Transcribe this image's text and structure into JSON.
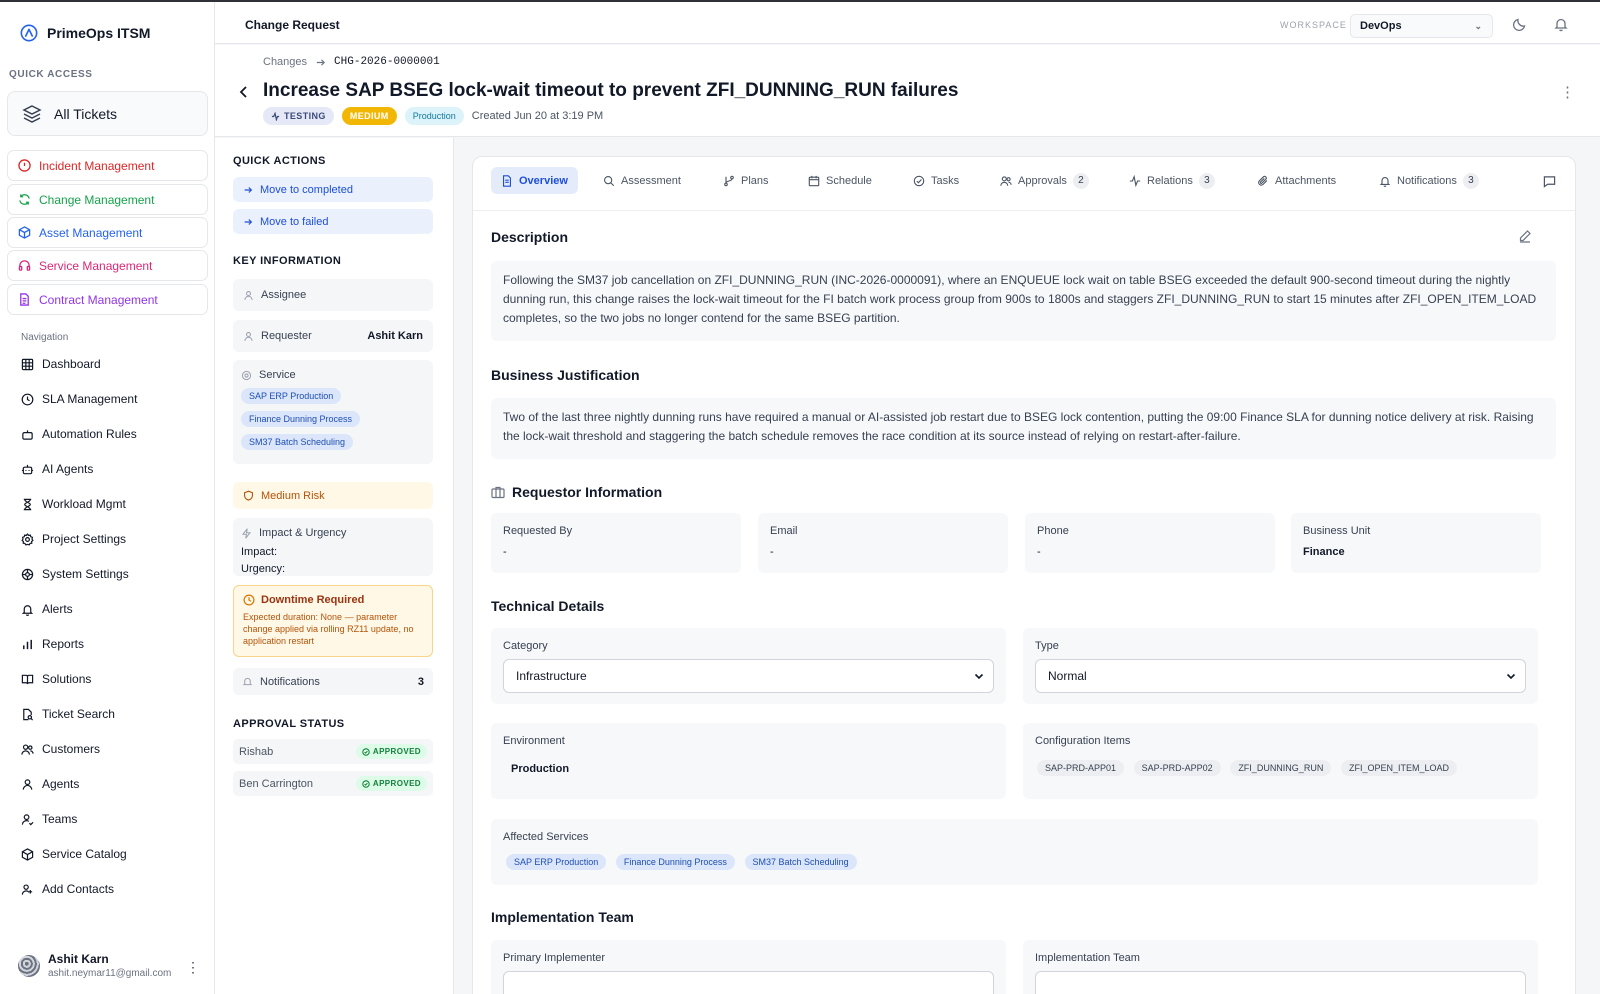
{
  "app": {
    "name": "PrimeOps ITSM"
  },
  "sidebar": {
    "quick_access_label": "QUICK ACCESS",
    "all_tickets": "All Tickets",
    "modules": [
      {
        "label": "Incident Management",
        "color": "#dc2626"
      },
      {
        "label": "Change Management",
        "color": "#16a34a"
      },
      {
        "label": "Asset Management",
        "color": "#2563eb"
      },
      {
        "label": "Service Management",
        "color": "#db2777"
      },
      {
        "label": "Contract Management",
        "color": "#9333ea"
      }
    ],
    "nav_label": "Navigation",
    "nav": [
      {
        "label": "Dashboard",
        "icon": "grid-icon"
      },
      {
        "label": "SLA Management",
        "icon": "clock-icon"
      },
      {
        "label": "Automation Rules",
        "icon": "robot-icon"
      },
      {
        "label": "AI Agents",
        "icon": "bot-icon"
      },
      {
        "label": "Workload Mgmt",
        "icon": "hourglass-icon"
      },
      {
        "label": "Project Settings",
        "icon": "gear-icon"
      },
      {
        "label": "System Settings",
        "icon": "cog-icon"
      },
      {
        "label": "Alerts",
        "icon": "bell-icon"
      },
      {
        "label": "Reports",
        "icon": "bar-chart-icon"
      },
      {
        "label": "Solutions",
        "icon": "book-icon"
      },
      {
        "label": "Ticket Search",
        "icon": "file-search-icon"
      },
      {
        "label": "Customers",
        "icon": "users-icon"
      },
      {
        "label": "Agents",
        "icon": "user-icon"
      },
      {
        "label": "Teams",
        "icon": "user-check-icon"
      },
      {
        "label": "Service Catalog",
        "icon": "box-icon"
      },
      {
        "label": "Add Contacts",
        "icon": "contact-icon"
      }
    ],
    "user": {
      "name": "Ashit Karn",
      "email": "ashit.neymar11@gmail.com"
    }
  },
  "topbar": {
    "title": "Change Request",
    "workspace_label": "WORKSPACE",
    "workspace_value": "DevOps"
  },
  "header": {
    "breadcrumb_parent": "Changes",
    "change_id": "CHG-2026-0000001",
    "title": "Increase SAP BSEG lock-wait timeout to prevent ZFI_DUNNING_RUN failures",
    "status": "TESTING",
    "priority": "MEDIUM",
    "environment": "Production",
    "created": "Created Jun 20 at 3:19 PM"
  },
  "left_panel": {
    "quick_actions_label": "QUICK ACTIONS",
    "actions": [
      "Move to completed",
      "Move to failed"
    ],
    "key_info_label": "KEY INFORMATION",
    "assignee_label": "Assignee",
    "requester_label": "Requester",
    "requester_value": "Ashit Karn",
    "service_label": "Service",
    "services": [
      "SAP ERP Production",
      "Finance Dunning Process",
      "SM37 Batch Scheduling"
    ],
    "risk": "Medium Risk",
    "impact_urgency_label": "Impact & Urgency",
    "impact_label": "Impact:",
    "urgency_label": "Urgency:",
    "downtime_title": "Downtime Required",
    "downtime_text": "Expected duration: None — parameter change applied via rolling RZ11 update, no application restart",
    "notifications_label": "Notifications",
    "notifications_count": "3",
    "approval_status_label": "APPROVAL STATUS",
    "approvals": [
      {
        "name": "Rishab",
        "status": "APPROVED"
      },
      {
        "name": "Ben Carrington",
        "status": "APPROVED"
      }
    ]
  },
  "tabs": [
    {
      "label": "Overview",
      "icon": "document-icon",
      "count": ""
    },
    {
      "label": "Assessment",
      "icon": "search-icon",
      "count": ""
    },
    {
      "label": "Plans",
      "icon": "git-branch-icon",
      "count": ""
    },
    {
      "label": "Schedule",
      "icon": "calendar-icon",
      "count": ""
    },
    {
      "label": "Tasks",
      "icon": "check-circle-icon",
      "count": ""
    },
    {
      "label": "Approvals",
      "icon": "users-icon",
      "count": "2"
    },
    {
      "label": "Relations",
      "icon": "activity-icon",
      "count": "3"
    },
    {
      "label": "Attachments",
      "icon": "paperclip-icon",
      "count": ""
    },
    {
      "label": "Notifications",
      "icon": "bell-icon",
      "count": "3"
    }
  ],
  "overview": {
    "description_label": "Description",
    "description": "Following the SM37 job cancellation on ZFI_DUNNING_RUN (INC-2026-0000091), where an ENQUEUE lock wait on table BSEG exceeded the default 900-second timeout during the nightly dunning run, this change raises the lock-wait timeout for the FI batch work process group from 900s to 1800s and staggers ZFI_DUNNING_RUN to start 15 minutes after ZFI_OPEN_ITEM_LOAD completes, so the two jobs no longer contend for the same BSEG partition.",
    "justification_label": "Business Justification",
    "justification": "Two of the last three nightly dunning runs have required a manual or AI-assisted job restart due to BSEG lock contention, putting the 09:00 Finance SLA for dunning notice delivery at risk. Raising the lock-wait threshold and staggering the batch schedule removes the race condition at its source instead of relying on restart-after-failure.",
    "requestor_label": "Requestor Information",
    "requestor": [
      {
        "key": "Requested By",
        "value": "-"
      },
      {
        "key": "Email",
        "value": "-"
      },
      {
        "key": "Phone",
        "value": "-"
      },
      {
        "key": "Business Unit",
        "value": "Finance"
      }
    ],
    "technical_label": "Technical Details",
    "category_label": "Category",
    "category_value": "Infrastructure",
    "type_label": "Type",
    "type_value": "Normal",
    "environment_label": "Environment",
    "environment_value": "Production",
    "ci_label": "Configuration Items",
    "config_items": [
      "SAP-PRD-APP01",
      "SAP-PRD-APP02",
      "ZFI_DUNNING_RUN",
      "ZFI_OPEN_ITEM_LOAD"
    ],
    "affected_label": "Affected Services",
    "affected_services": [
      "SAP ERP Production",
      "Finance Dunning Process",
      "SM37 Batch Scheduling"
    ],
    "impl_team_label": "Implementation Team",
    "primary_implementer_label": "Primary Implementer",
    "implementation_team_label": "Implementation Team"
  }
}
